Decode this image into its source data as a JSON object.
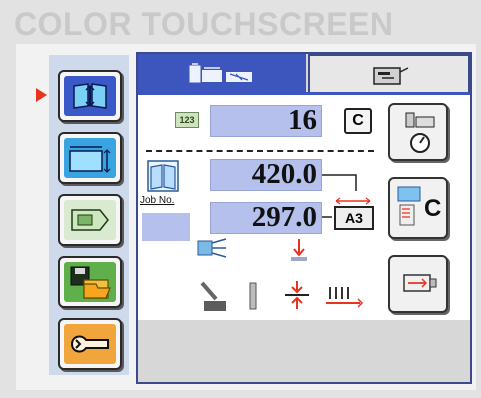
{
  "page_title": "COLOR TOUCHSCREEN",
  "sidebar": {
    "active_index": 0,
    "items": [
      {
        "name": "sidebar-item-book-mode",
        "icon": "book-icon"
      },
      {
        "name": "sidebar-item-paper-size",
        "icon": "paper-size-icon"
      },
      {
        "name": "sidebar-item-document",
        "icon": "document-icon"
      },
      {
        "name": "sidebar-item-save-job",
        "icon": "floppy-folder-icon"
      },
      {
        "name": "sidebar-item-service",
        "icon": "wrench-icon"
      }
    ]
  },
  "tabs": [
    {
      "icon": "cutter-machine-icon"
    },
    {
      "icon": "output-tray-icon"
    }
  ],
  "panel": {
    "counter_small_label": "123",
    "count_value": "16",
    "count_button": "C",
    "width_value": "420.0",
    "height_value": "297.0",
    "paper_size_label": "A3",
    "job_label": "Job No.",
    "clear_button": "C"
  },
  "colors": {
    "accent_blue": "#3d56bd",
    "value_field": "#b5c1ec",
    "indicator_red": "#e8331f",
    "title_gray": "#c9c9c9"
  }
}
